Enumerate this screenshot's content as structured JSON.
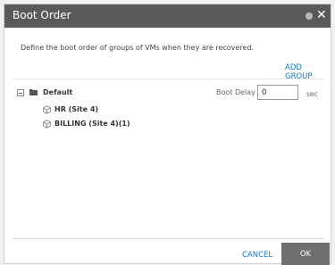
{
  "dialog": {
    "title": "Boot Order",
    "description": "Define the boot order of groups of VMs when they are recovered.",
    "add_group_label": "ADD GROUP"
  },
  "group": {
    "name": "Default",
    "boot_delay_label": "Boot Delay",
    "boot_delay_value": "0",
    "unit_label": "sec",
    "vms": [
      {
        "name": "HR (Site 4)"
      },
      {
        "name": "BILLING (Site 4)(1)"
      }
    ]
  },
  "footer": {
    "cancel_label": "CANCEL",
    "ok_label": "OK"
  },
  "icons": {
    "help": "help-icon",
    "close": "close-icon",
    "tree_toggle": "collapse-icon",
    "folder": "folder-icon",
    "vm": "vm-icon"
  },
  "colors": {
    "titlebar": "#5a5a5a",
    "link": "#1877c7",
    "ok_button": "#6e6e6e"
  }
}
